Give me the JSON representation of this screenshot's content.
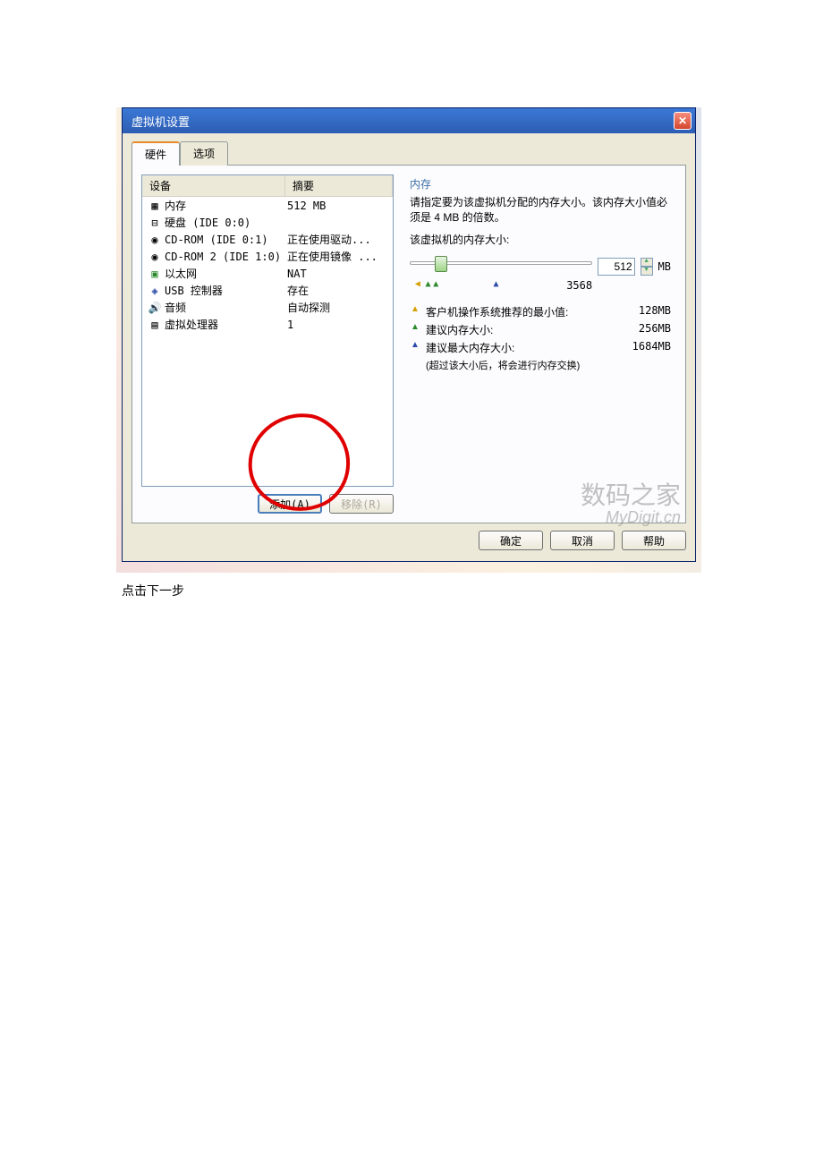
{
  "dialog": {
    "title": "虚拟机设置",
    "tabs": {
      "hardware": "硬件",
      "options": "选项"
    },
    "list_headers": {
      "device": "设备",
      "summary": "摘要"
    },
    "devices": [
      {
        "icon": "memory",
        "name": "内存",
        "summary": "512 MB"
      },
      {
        "icon": "disk",
        "name": "硬盘 (IDE 0:0)",
        "summary": ""
      },
      {
        "icon": "cdrom",
        "name": "CD-ROM (IDE 0:1)",
        "summary": "正在使用驱动..."
      },
      {
        "icon": "cdrom",
        "name": "CD-ROM 2 (IDE 1:0)",
        "summary": "正在使用镜像 ..."
      },
      {
        "icon": "network",
        "name": "以太网",
        "summary": "NAT"
      },
      {
        "icon": "usb",
        "name": "USB 控制器",
        "summary": "存在"
      },
      {
        "icon": "audio",
        "name": "音频",
        "summary": "自动探测"
      },
      {
        "icon": "cpu",
        "name": "虚拟处理器",
        "summary": "1"
      }
    ],
    "buttons": {
      "add": "添加(A)",
      "remove": "移除(R)",
      "ok": "确定",
      "cancel": "取消",
      "help": "帮助"
    }
  },
  "memory_panel": {
    "title": "内存",
    "desc": "请指定要为该虚拟机分配的内存大小。该内存大小值必须是 4 MB 的倍数。",
    "size_label": "该虚拟机的内存大小:",
    "value": "512",
    "unit": "MB",
    "max_label": "3568",
    "legend": {
      "min": {
        "text": "客户机操作系统推荐的最小值:",
        "val": "128MB"
      },
      "rec": {
        "text": "建议内存大小:",
        "val": "256MB"
      },
      "max": {
        "text": "建议最大内存大小:",
        "val": "1684MB"
      },
      "note": "(超过该大小后，将会进行内存交换)"
    }
  },
  "watermark": {
    "line1": "数码之家",
    "line2": "MyDigit.cn"
  },
  "instruction": "点击下一步"
}
